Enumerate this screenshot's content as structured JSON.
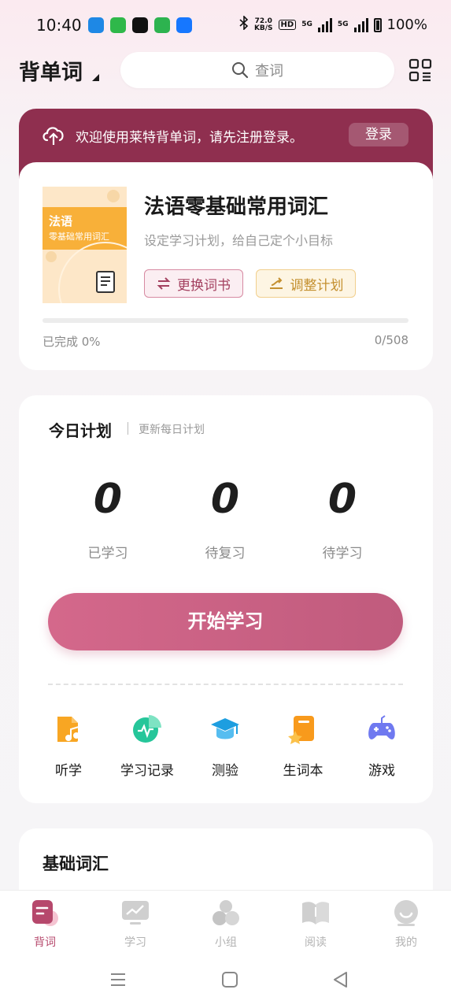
{
  "status_bar": {
    "time": "10:40",
    "speed": "72.0",
    "speed_unit": "KB/S",
    "hd": "HD",
    "net1": "5G",
    "net2": "5G",
    "battery": "100%",
    "notif_colors": [
      "#1e88e5",
      "#2fb84a",
      "#111111",
      "#2db34f",
      "#1677ff"
    ]
  },
  "header": {
    "title": "背单词",
    "search_placeholder": "查词"
  },
  "banner": {
    "text": "欢迎使用莱特背单词，请先注册登录。",
    "login_label": "登录",
    "bg_color": "#8f2f4f"
  },
  "book": {
    "cover_title": "法语",
    "cover_subtitle": "零基础常用词汇",
    "title": "法语零基础常用词汇",
    "subtitle": "设定学习计划，给自己定个小目标",
    "change_label": "更换词书",
    "plan_label": "调整计划",
    "progress_text": "已完成 0%",
    "progress_fraction": 0,
    "count_text": "0/508"
  },
  "plan": {
    "title": "今日计划",
    "update_label": "更新每日计划",
    "stats": [
      {
        "value": "0",
        "label": "已学习"
      },
      {
        "value": "0",
        "label": "待复习"
      },
      {
        "value": "0",
        "label": "待学习"
      }
    ],
    "start_label": "开始学习",
    "tools": [
      {
        "label": "听学",
        "icon": "music-note-icon"
      },
      {
        "label": "学习记录",
        "icon": "chart-record-icon"
      },
      {
        "label": "测验",
        "icon": "graduation-cap-icon"
      },
      {
        "label": "生词本",
        "icon": "star-notebook-icon"
      },
      {
        "label": "游戏",
        "icon": "gamepad-icon"
      }
    ]
  },
  "vocab": {
    "title": "基础词汇"
  },
  "bottom_nav": {
    "items": [
      {
        "label": "背词",
        "active": true
      },
      {
        "label": "学习",
        "active": false
      },
      {
        "label": "小组",
        "active": false
      },
      {
        "label": "阅读",
        "active": false
      },
      {
        "label": "我的",
        "active": false
      }
    ],
    "accent": "#b6486c"
  }
}
